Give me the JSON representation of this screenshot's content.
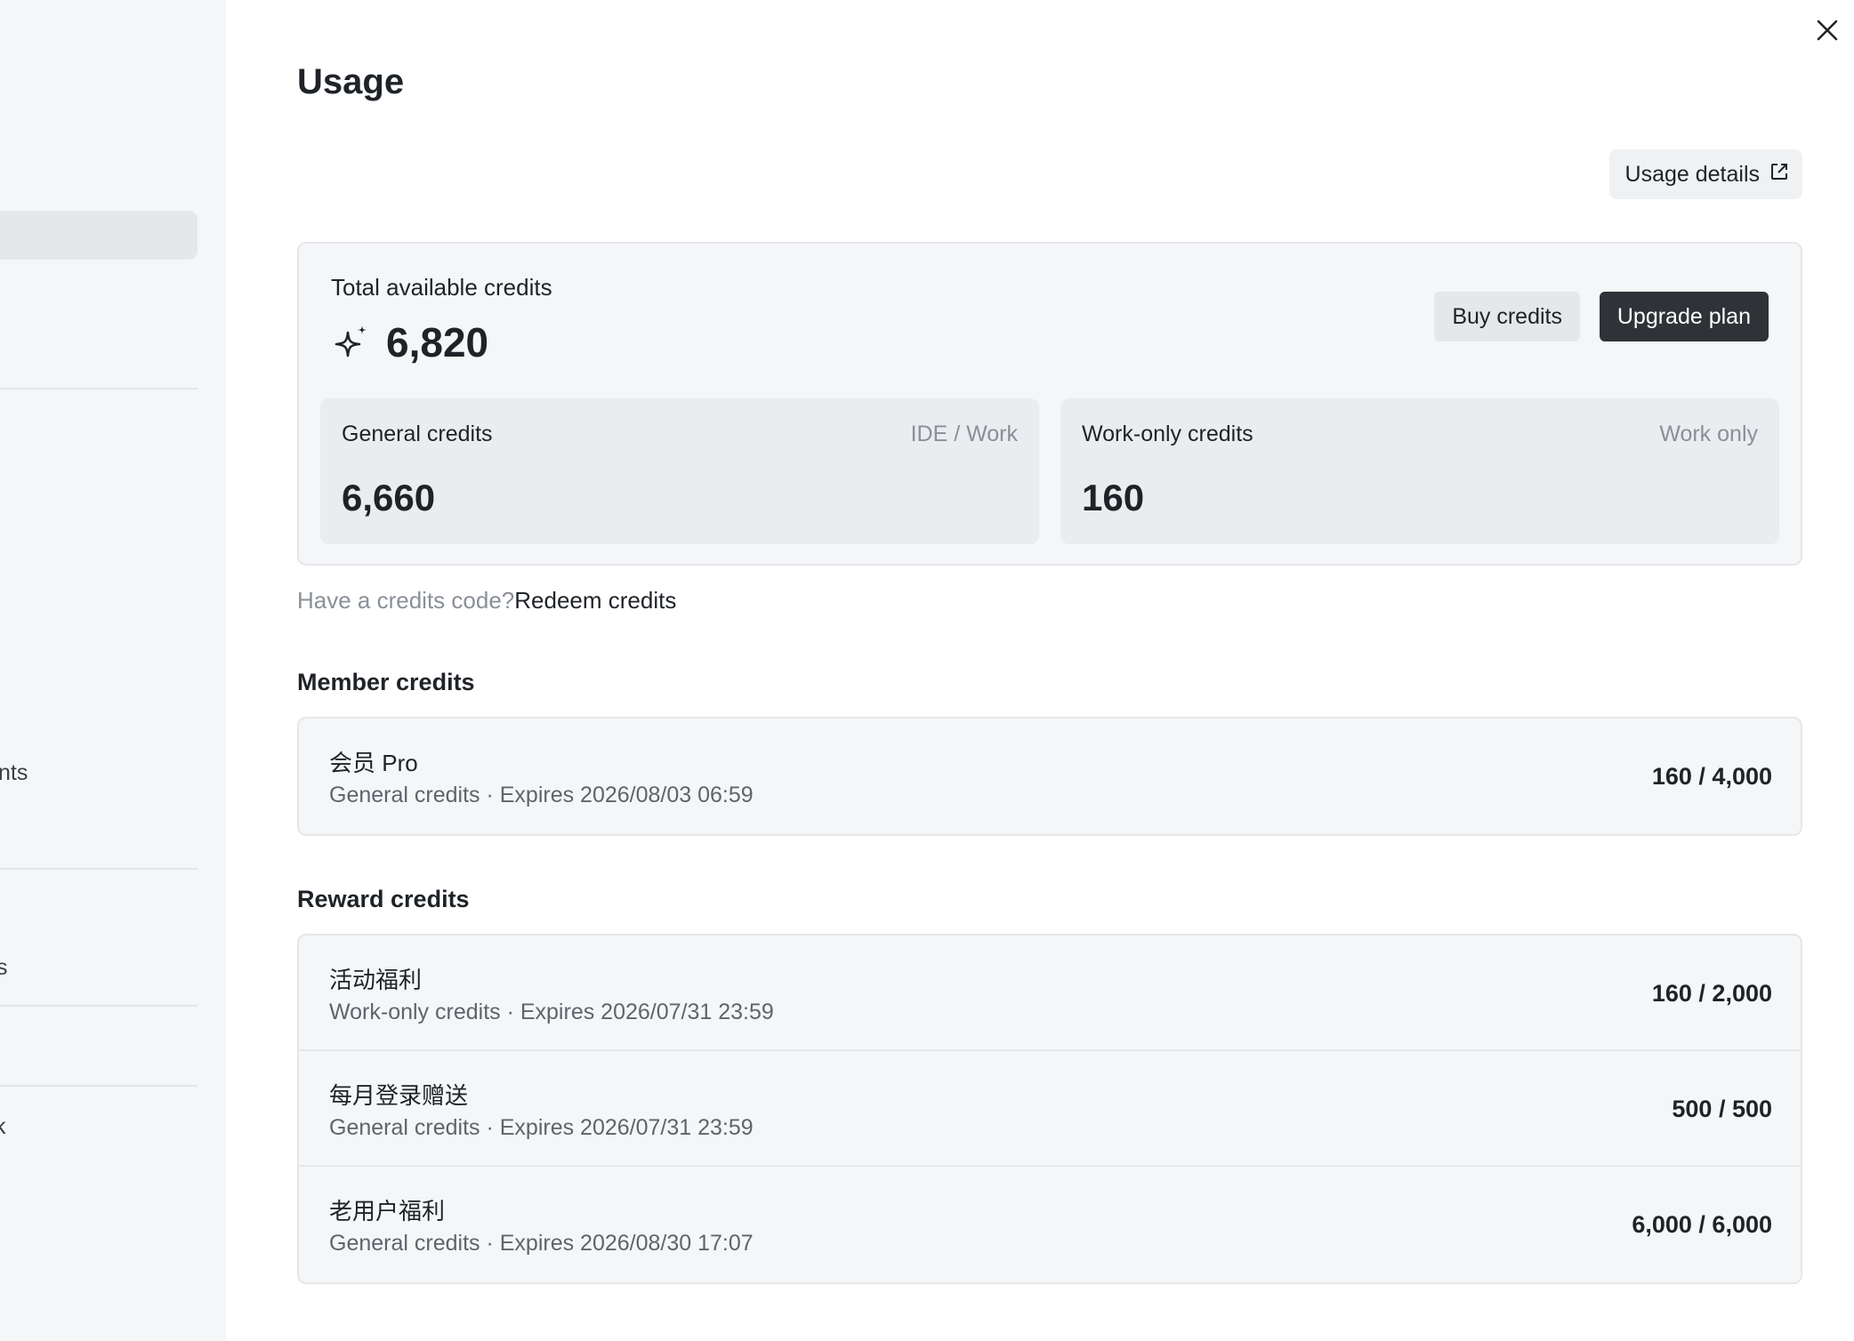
{
  "sidebar": {
    "fragments": [
      "nts",
      "s",
      "k"
    ]
  },
  "header": {
    "title": "Usage",
    "usage_details_label": "Usage details"
  },
  "total": {
    "label": "Total available credits",
    "value": "6,820",
    "buy_label": "Buy credits",
    "upgrade_label": "Upgrade plan",
    "general": {
      "label": "General credits",
      "tag": "IDE / Work",
      "value": "6,660"
    },
    "work_only": {
      "label": "Work-only credits",
      "tag": "Work only",
      "value": "160"
    }
  },
  "redeem": {
    "prompt": "Have a credits code?",
    "link": "Redeem credits"
  },
  "member": {
    "title": "Member credits",
    "items": [
      {
        "name": "会员 Pro",
        "sub": "General credits · Expires 2026/08/03 06:59",
        "amount": "160 / 4,000"
      }
    ]
  },
  "reward": {
    "title": "Reward credits",
    "items": [
      {
        "name": "活动福利",
        "sub": "Work-only credits · Expires 2026/07/31 23:59",
        "amount": "160 / 2,000"
      },
      {
        "name": "每月登录赠送",
        "sub": "General credits · Expires 2026/07/31 23:59",
        "amount": "500 / 500"
      },
      {
        "name": "老用户福利",
        "sub": "General credits · Expires 2026/08/30 17:07",
        "amount": "6,000 / 6,000"
      }
    ]
  },
  "icons": {
    "close": "close-icon",
    "external_link": "external-link-icon",
    "sparkle": "sparkle-icon"
  }
}
